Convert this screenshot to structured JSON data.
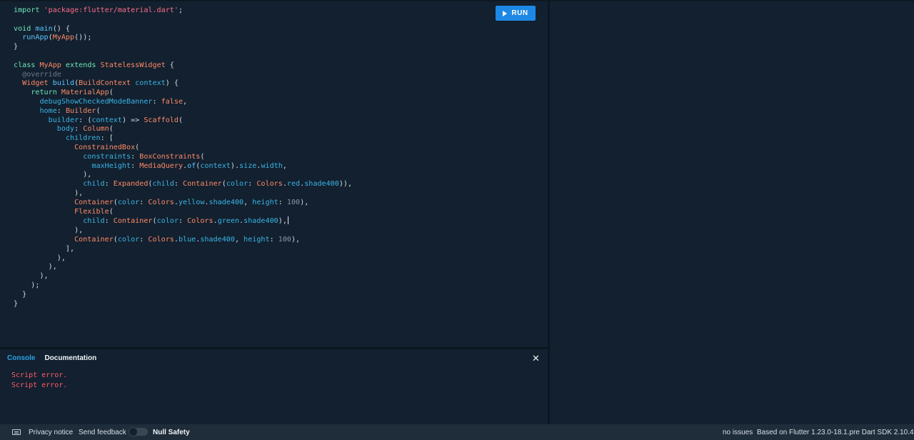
{
  "editor": {
    "run_label": "RUN",
    "code": {
      "l1a": "import ",
      "l1b": "'package:flutter/material.dart'",
      "l1c": ";",
      "l3a": "void ",
      "l3b": "main",
      "l3c": "() {",
      "l4a": "  ",
      "l4b": "runApp",
      "l4c": "(",
      "l4d": "MyApp",
      "l4e": "());",
      "l5": "}",
      "l7a": "class ",
      "l7b": "MyApp",
      "l7c": " extends ",
      "l7d": "StatelessWidget",
      "l7e": " {",
      "l8": "  @override",
      "l9a": "  ",
      "l9b": "Widget",
      "l9c": " ",
      "l9d": "build",
      "l9e": "(",
      "l9f": "BuildContext",
      "l9g": " ",
      "l9h": "context",
      "l9i": ") {",
      "l10a": "    ",
      "l10b": "return",
      "l10c": " ",
      "l10d": "MaterialApp",
      "l10e": "(",
      "l11a": "      ",
      "l11b": "debugShowCheckedModeBanner",
      "l11c": ": ",
      "l11d": "false",
      "l11e": ",",
      "l12a": "      ",
      "l12b": "home",
      "l12c": ": ",
      "l12d": "Builder",
      "l12e": "(",
      "l13a": "        ",
      "l13b": "builder",
      "l13c": ": (",
      "l13d": "context",
      "l13e": ") => ",
      "l13f": "Scaffold",
      "l13g": "(",
      "l14a": "          ",
      "l14b": "body",
      "l14c": ": ",
      "l14d": "Column",
      "l14e": "(",
      "l15a": "            ",
      "l15b": "children",
      "l15c": ": [",
      "l16a": "              ",
      "l16b": "ConstrainedBox",
      "l16c": "(",
      "l17a": "                ",
      "l17b": "constraints",
      "l17c": ": ",
      "l17d": "BoxConstraints",
      "l17e": "(",
      "l18a": "                  ",
      "l18b": "maxHeight",
      "l18c": ": ",
      "l18d": "MediaQuery",
      "l18e": ".",
      "l18f": "of",
      "l18g": "(",
      "l18h": "context",
      "l18i": ").",
      "l18j": "size",
      "l18k": ".",
      "l18l": "width",
      "l18m": ",",
      "l19": "                ),",
      "l20a": "                ",
      "l20b": "child",
      "l20c": ": ",
      "l20d": "Expanded",
      "l20e": "(",
      "l20f": "child",
      "l20g": ": ",
      "l20h": "Container",
      "l20i": "(",
      "l20j": "color",
      "l20k": ": ",
      "l20l": "Colors",
      "l20m": ".",
      "l20n": "red",
      "l20o": ".",
      "l20p": "shade400",
      "l20q": ")),",
      "l21": "              ),",
      "l22a": "              ",
      "l22b": "Container",
      "l22c": "(",
      "l22d": "color",
      "l22e": ": ",
      "l22f": "Colors",
      "l22g": ".",
      "l22h": "yellow",
      "l22i": ".",
      "l22j": "shade400",
      "l22k": ", ",
      "l22l": "height",
      "l22m": ": ",
      "l22n": "100",
      "l22o": "),",
      "l23a": "              ",
      "l23b": "Flexible",
      "l23c": "(",
      "l24a": "                ",
      "l24b": "child",
      "l24c": ": ",
      "l24d": "Container",
      "l24e": "(",
      "l24f": "color",
      "l24g": ": ",
      "l24h": "Colors",
      "l24i": ".",
      "l24j": "green",
      "l24k": ".",
      "l24l": "shade400",
      "l24m": "),",
      "l25": "              ),",
      "l26a": "              ",
      "l26b": "Container",
      "l26c": "(",
      "l26d": "color",
      "l26e": ": ",
      "l26f": "Colors",
      "l26g": ".",
      "l26h": "blue",
      "l26i": ".",
      "l26j": "shade400",
      "l26k": ", ",
      "l26l": "height",
      "l26m": ": ",
      "l26n": "100",
      "l26o": "),",
      "l27": "            ],",
      "l28": "          ),",
      "l29": "        ),",
      "l30": "      ),",
      "l31": "    );",
      "l32": "  }",
      "l33": "}"
    }
  },
  "console": {
    "tabs": [
      "Console",
      "Documentation"
    ],
    "close_symbol": "✕",
    "lines": [
      "Script error.",
      "Script error."
    ]
  },
  "footer": {
    "privacy": "Privacy notice",
    "feedback": "Send feedback",
    "null_safety": "Null Safety",
    "issues": "no issues",
    "version": "Based on Flutter 1.23.0-18.1.pre Dart SDK 2.10.4"
  },
  "colors": {
    "accent": "#1e88e5",
    "keyword": "#6ee8b9",
    "type": "#ff8a66",
    "function": "#5dc4ff",
    "string": "#ff6a8a",
    "error": "#ff5a6a",
    "background": "#12202f"
  },
  "icons": {
    "run": "play-icon",
    "close": "close-icon",
    "keyboard": "keyboard-icon"
  }
}
